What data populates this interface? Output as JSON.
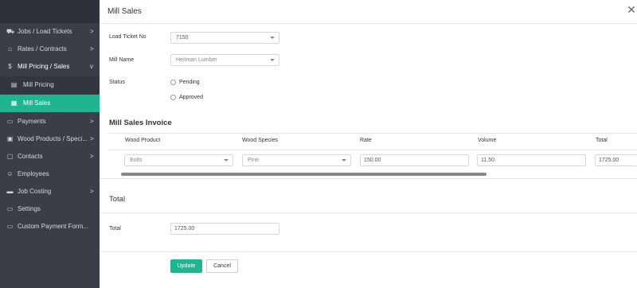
{
  "sidebar": {
    "items": [
      {
        "label": "Jobs / Load Tickets",
        "icon": "truck-icon",
        "chevron": ">"
      },
      {
        "label": "Rates / Contracts",
        "icon": "tag-icon",
        "chevron": ">"
      },
      {
        "label": "Mill Pricing / Sales",
        "icon": "dollar-icon",
        "chevron": "v"
      },
      {
        "label": "Mill Pricing",
        "icon": "price-list-icon"
      },
      {
        "label": "Mill Sales",
        "icon": "bar-chart-icon"
      },
      {
        "label": "Payments",
        "icon": "card-icon",
        "chevron": ">"
      },
      {
        "label": "Wood Products / Speci...",
        "icon": "tree-icon",
        "chevron": ">"
      },
      {
        "label": "Contacts",
        "icon": "contacts-icon",
        "chevron": ">"
      },
      {
        "label": "Employees",
        "icon": "user-icon"
      },
      {
        "label": "Job Costing",
        "icon": "money-icon",
        "chevron": ">"
      },
      {
        "label": "Settings",
        "icon": "monitor-icon"
      },
      {
        "label": "Custom Payment Form...",
        "icon": "monitor-icon"
      }
    ]
  },
  "modal": {
    "title": "Mill Sales",
    "close_glyph": "✕"
  },
  "form": {
    "load_ticket_label": "Load Ticket No",
    "load_ticket_value": "7150",
    "mill_name_label": "Mill Name",
    "mill_name_value": "Heitman Lumber",
    "status_label": "Status",
    "status_options": [
      "Pending",
      "Approved"
    ]
  },
  "invoice": {
    "title": "Mill Sales Invoice",
    "columns": [
      "Wood Product",
      "Wood Species",
      "Rate",
      "Volume",
      "Total"
    ],
    "rows": [
      {
        "wood_product": "Bolts",
        "wood_species": "Pine",
        "rate": "150.00",
        "volume": "11.50",
        "total": "1725.00"
      }
    ]
  },
  "totals": {
    "title": "Total",
    "total_label": "Total",
    "total_value": "1725.00"
  },
  "actions": {
    "update_label": "Update",
    "cancel_label": "Cancel"
  },
  "colors": {
    "accent": "#1fb591",
    "sidebar_bg": "#3b3d48"
  }
}
